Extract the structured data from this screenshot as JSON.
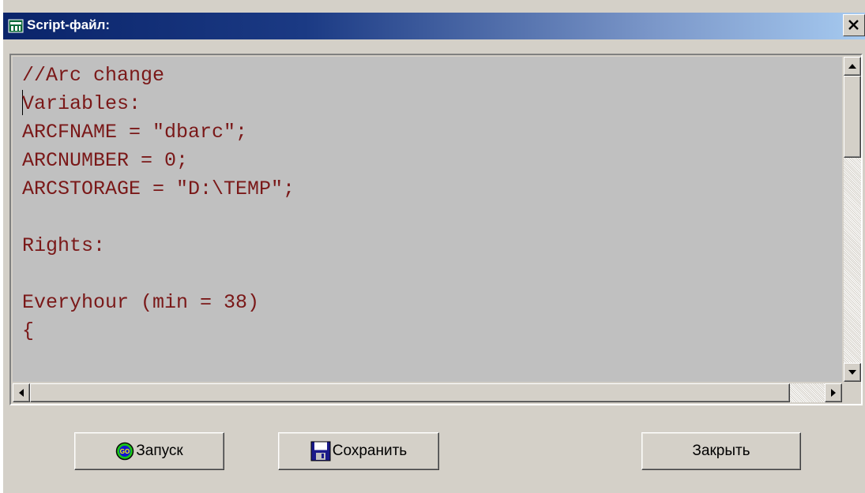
{
  "window": {
    "title": "Script-файл:",
    "close_glyph": "×"
  },
  "editor": {
    "lines": [
      "//Arc change",
      "Variables:",
      "ARCFNAME = \"dbarc\";",
      "ARCNUMBER = 0;",
      "ARCSTORAGE = \"D:\\TEMP\";",
      "",
      "Rights:",
      "",
      "Everyhour (min = 38)",
      "{"
    ],
    "text_color": "#7a1818",
    "background_color": "#c0c0c0"
  },
  "buttons": {
    "run_label": "Запуск",
    "run_icon": "go-icon",
    "save_label": "Сохранить",
    "save_icon": "floppy-disk-icon",
    "close_label": "Закрыть"
  },
  "colors": {
    "titlebar_start": "#0a246a",
    "titlebar_end": "#a6caf0",
    "window_face": "#d4d0c8"
  }
}
